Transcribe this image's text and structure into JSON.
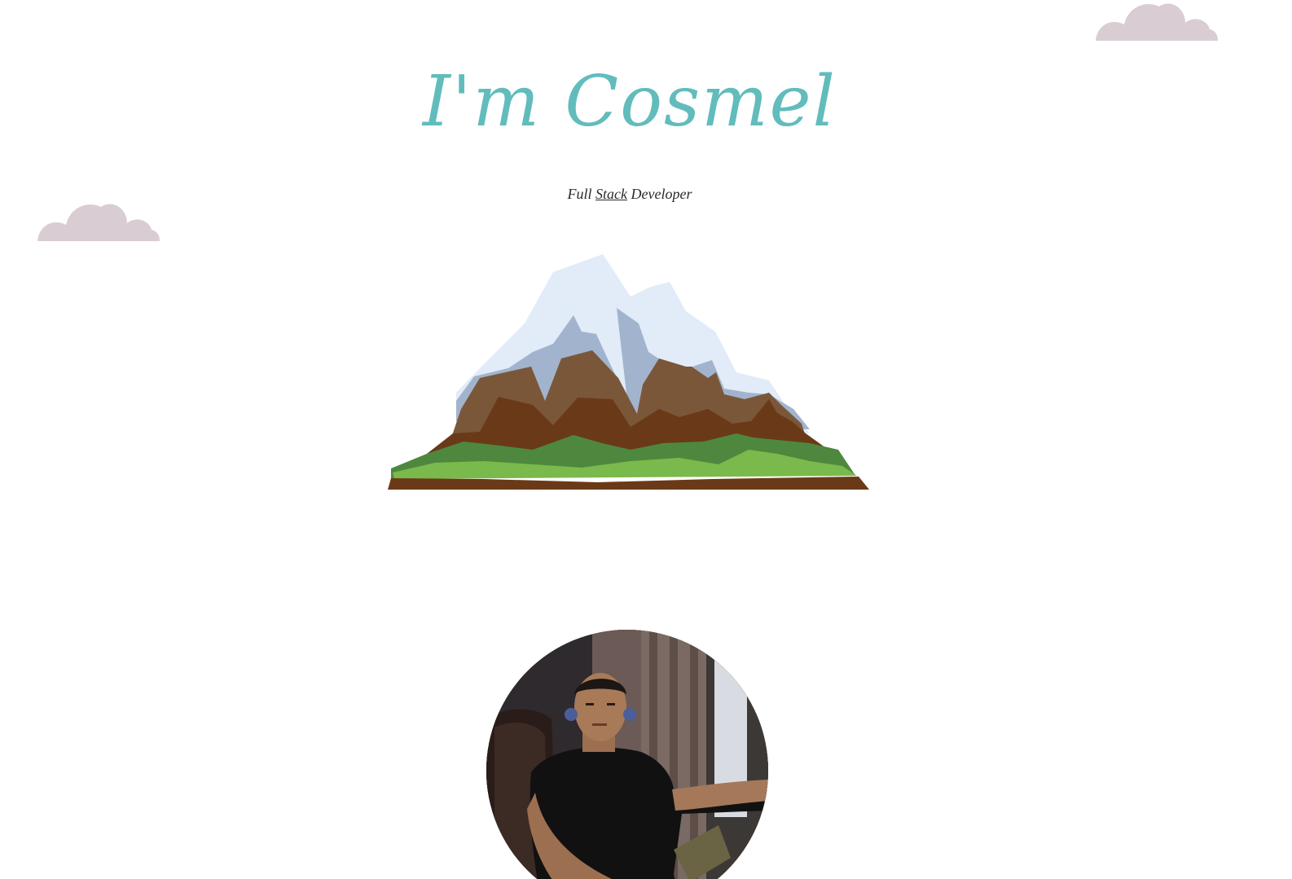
{
  "hero": {
    "title": "I'm Cosmel"
  },
  "subtitle": {
    "prefix": "Full",
    "link": "Stack",
    "suffix": "Developer"
  },
  "colors": {
    "title": "#62bcbc",
    "cloud": "#d9cdd3",
    "snow": "#e1ecf8",
    "rock": "#a2b4cd",
    "brown": "#7b573a",
    "dark_brown": "#6a3a18",
    "dark_green": "#4e883e",
    "light_green": "#7ab94b"
  },
  "icons": {
    "cloud": "cloud-icon",
    "mountain": "mountain-illustration",
    "avatar": "profile-photo"
  }
}
